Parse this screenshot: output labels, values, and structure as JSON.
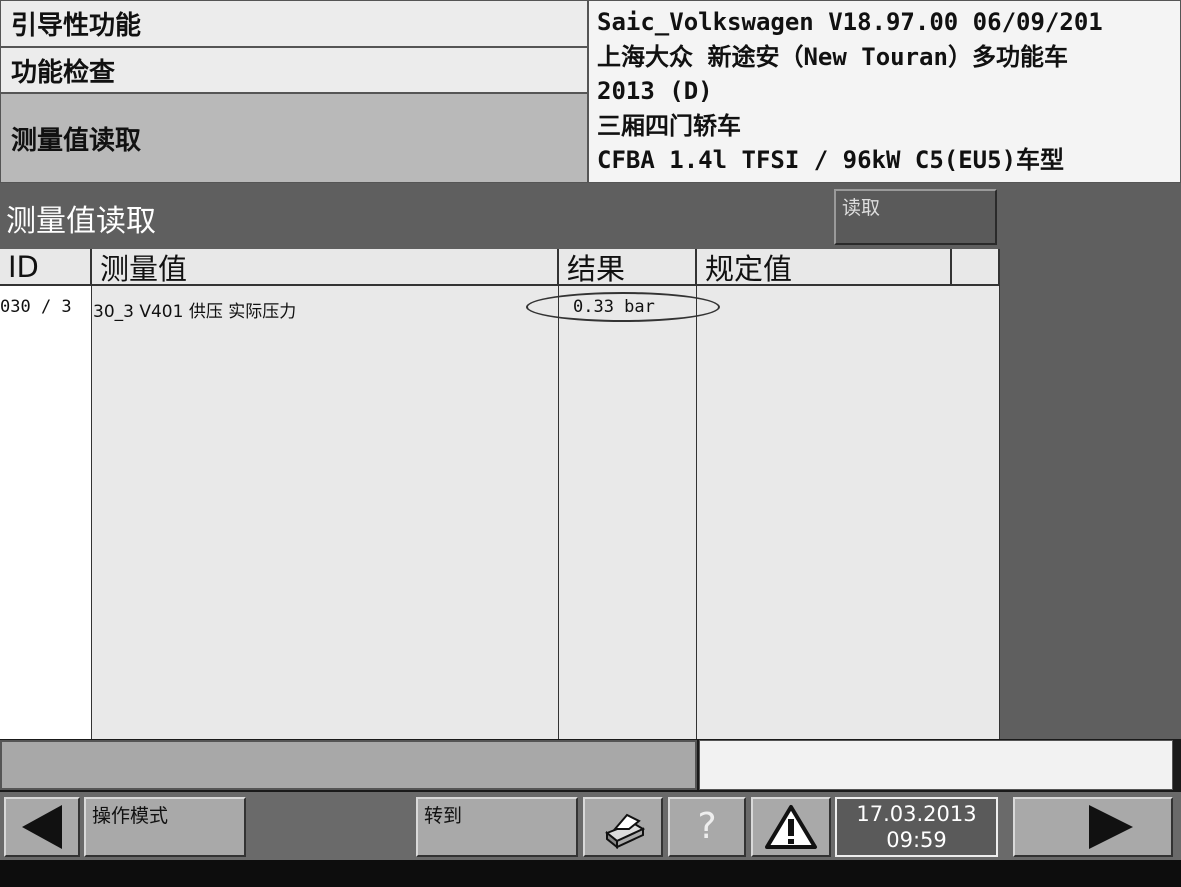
{
  "nav": {
    "guided_functions": "引导性功能",
    "function_check": "功能检查",
    "measured_values_read": "测量值读取"
  },
  "vehicle": {
    "line1": "Saic_Volkswagen  V18.97.00 06/09/201",
    "line2": "上海大众 新途安（New Touran）多功能车",
    "line3": "2013 (D)",
    "line4": "三厢四门轿车",
    "line5": "CFBA 1.4l TFSI / 96kW C5(EU5)车型"
  },
  "main": {
    "title": "测量值读取",
    "read_button": "读取"
  },
  "table": {
    "headers": {
      "id": "ID",
      "measured_value": "测量值",
      "result": "结果",
      "specified": "规定值"
    },
    "rows": [
      {
        "id": "030 / 3",
        "measured_value": "30_3 V401 供压 实际压力",
        "result": "0.33 bar",
        "specified": ""
      }
    ]
  },
  "toolbar": {
    "operation_mode": "操作模式",
    "goto": "转到",
    "help": "?",
    "date": "17.03.2013",
    "time": "09:59"
  },
  "icons": {
    "back": "left-arrow-icon",
    "forward": "right-arrow-icon",
    "print": "printer-icon",
    "warning": "warning-icon"
  }
}
